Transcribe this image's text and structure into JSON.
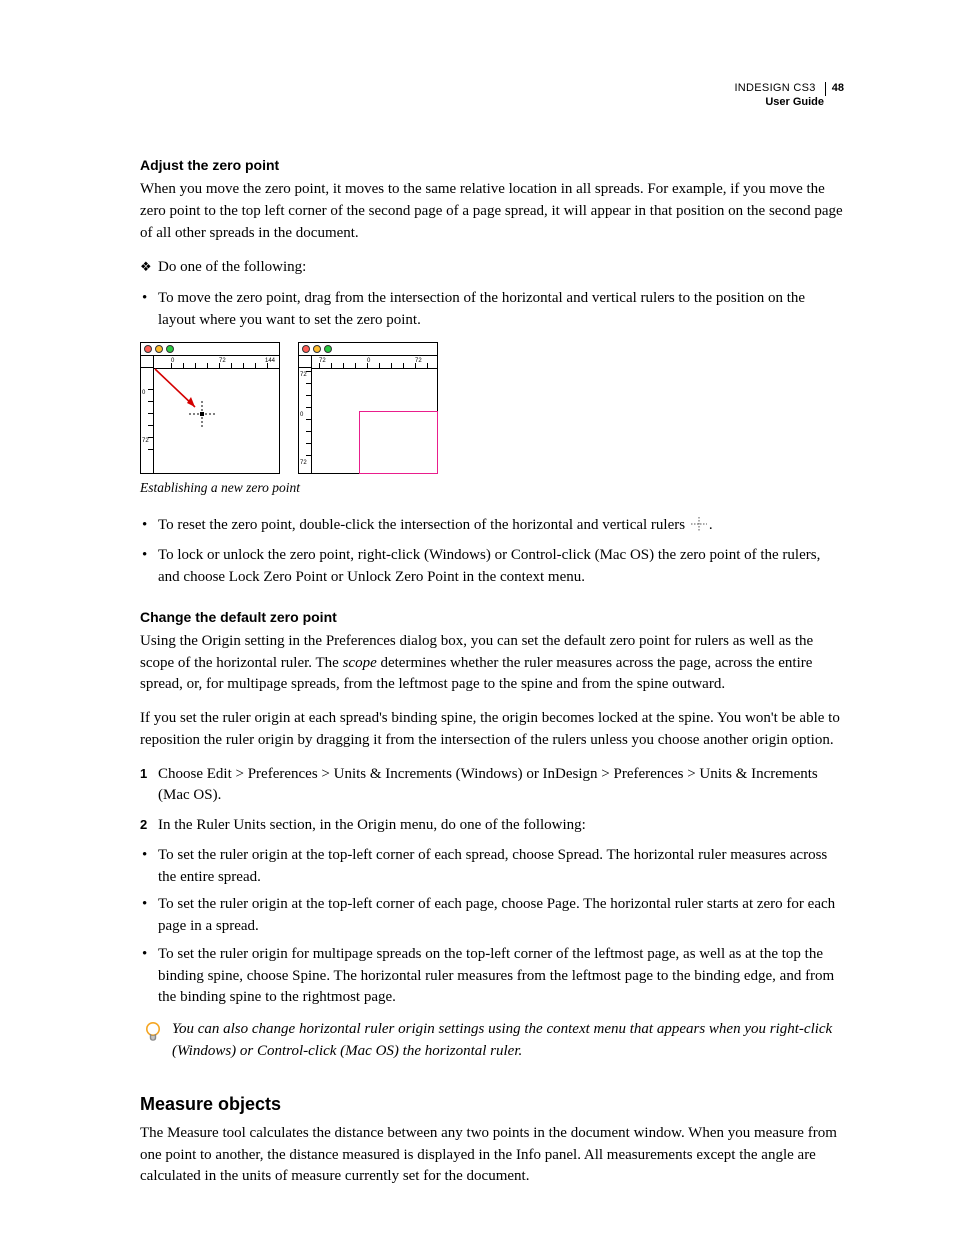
{
  "header": {
    "product": "INDESIGN CS3",
    "guide": "User Guide",
    "page_number": "48"
  },
  "section1": {
    "heading": "Adjust the zero point",
    "intro": "When you move the zero point, it moves to the same relative location in all spreads. For example, if you move the zero point to the top left corner of the second page of a page spread, it will appear in that position on the second page of all other spreads in the document.",
    "lead": "Do one of the following:",
    "bullets_a": [
      "To move the zero point, drag from the intersection of the horizontal and vertical rulers to the position on the layout where you want to set the zero point."
    ],
    "figure_caption": "Establishing a new zero point",
    "bullets_b": [
      "To reset the zero point, double-click the intersection of the horizontal and vertical rulers ",
      "To lock or unlock the zero point, right-click (Windows) or Control-click (Mac OS) the zero point of the rulers, and choose Lock Zero Point or Unlock Zero Point in the context menu."
    ],
    "reset_suffix": "."
  },
  "section2": {
    "heading": "Change the default zero point",
    "p1_a": "Using the Origin setting in the Preferences dialog box, you can set the default zero point for rulers as well as the scope of the horizontal ruler. The ",
    "p1_em": "scope",
    "p1_b": " determines whether the ruler measures across the page, across the entire spread, or, for multipage spreads, from the leftmost page to the spine and from the spine outward.",
    "p2": "If you set the ruler origin at each spread's binding spine, the origin becomes locked at the spine. You won't be able to reposition the ruler origin by dragging it from the intersection of the rulers unless you choose another origin option.",
    "steps": [
      "Choose Edit > Preferences > Units & Increments (Windows) or InDesign > Preferences > Units & Increments (Mac OS).",
      "In the Ruler Units section, in the Origin menu, do one of the following:"
    ],
    "bullets": [
      "To set the ruler origin at the top-left corner of each spread, choose Spread. The horizontal ruler measures across the entire spread.",
      "To set the ruler origin at the top-left corner of each page, choose Page. The horizontal ruler starts at zero for each page in a spread.",
      "To set the ruler origin for multipage spreads on the top-left corner of the leftmost page, as well as at the top the binding spine, choose Spine. The horizontal ruler measures from the leftmost page to the binding edge, and from the binding spine to the rightmost page."
    ],
    "tip": "You can also change horizontal ruler origin settings using the context menu that appears when you right-click (Windows) or Control-click (Mac OS) the horizontal ruler."
  },
  "section3": {
    "heading": "Measure objects",
    "p1": "The Measure tool calculates the distance between any two points in the document window. When you measure from one point to another, the distance measured is displayed in the Info panel. All measurements except the angle are calculated in the units of measure currently set for the document."
  },
  "figure": {
    "ruler_labels_left": [
      "0",
      "72",
      "144"
    ],
    "ruler_labels_left_v": [
      "0",
      "72"
    ],
    "ruler_labels_right": [
      "72",
      "0",
      "72"
    ],
    "ruler_labels_right_v": [
      "72",
      "0",
      "72"
    ]
  }
}
